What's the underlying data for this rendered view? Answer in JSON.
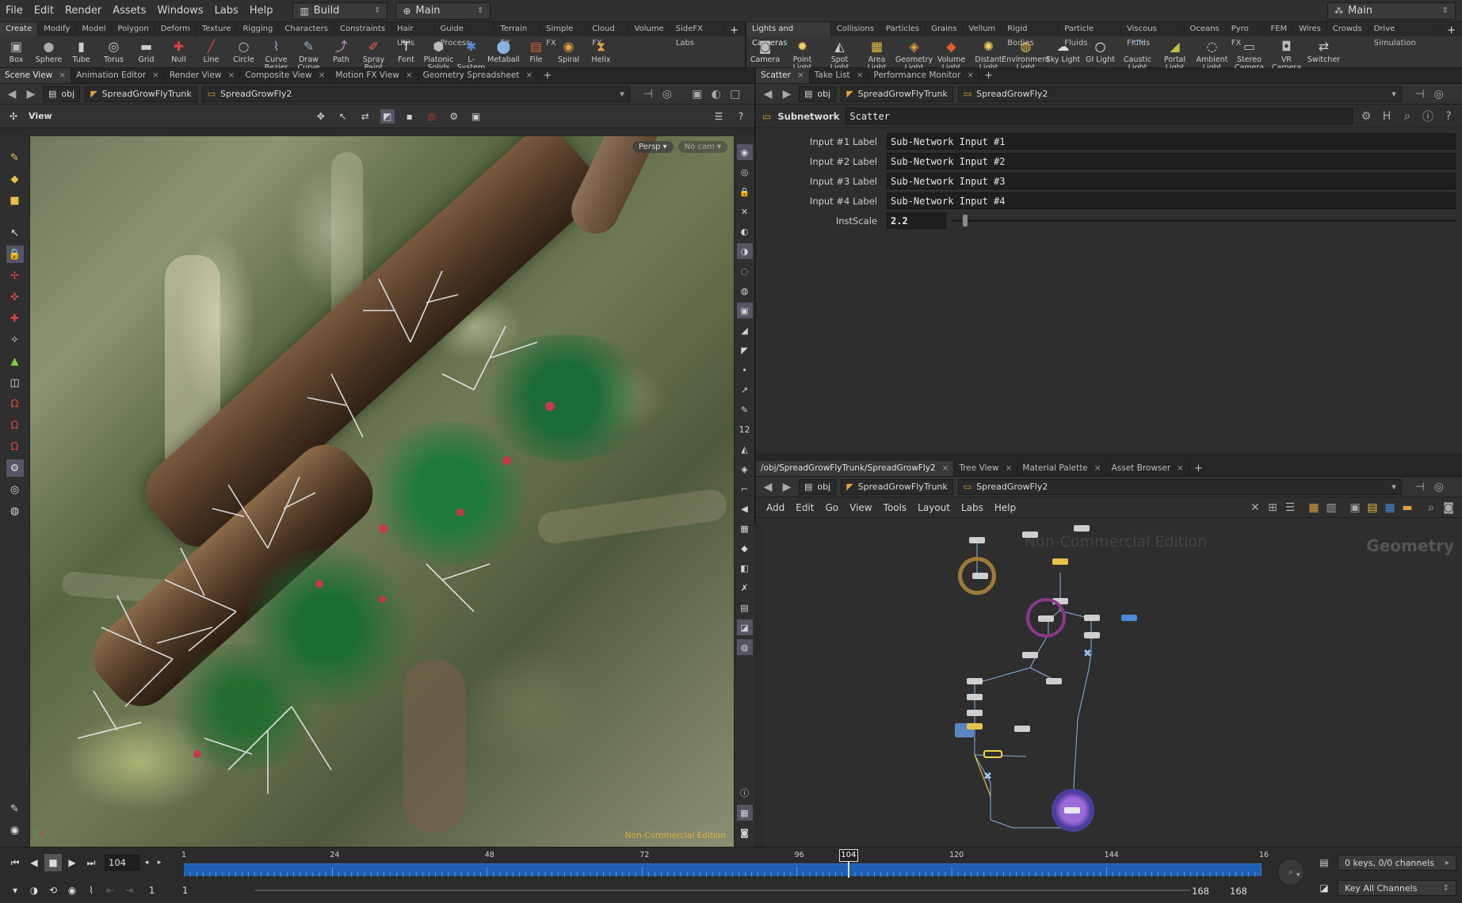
{
  "menubar": {
    "items": [
      "File",
      "Edit",
      "Render",
      "Assets",
      "Windows",
      "Labs",
      "Help"
    ],
    "desktop": "Build",
    "context": "Main",
    "right_context": "Main"
  },
  "left_shelf": {
    "tabs": [
      "Create",
      "Modify",
      "Model",
      "Polygon",
      "Deform",
      "Texture",
      "Rigging",
      "Characters",
      "Constraints",
      "Hair Utils",
      "Guide Process",
      "Terrain FX",
      "Simple FX",
      "Cloud FX",
      "Volume",
      "SideFX Labs"
    ],
    "tools": [
      {
        "label": "Box",
        "icon": "box-icon",
        "glyph": "▣"
      },
      {
        "label": "Sphere",
        "icon": "sphere-icon",
        "glyph": "●"
      },
      {
        "label": "Tube",
        "icon": "tube-icon",
        "glyph": "▮"
      },
      {
        "label": "Torus",
        "icon": "torus-icon",
        "glyph": "◎"
      },
      {
        "label": "Grid",
        "icon": "grid-icon",
        "glyph": "▬"
      },
      {
        "label": "Null",
        "icon": "null-icon",
        "glyph": "✚"
      },
      {
        "label": "Line",
        "icon": "line-icon",
        "glyph": "╱"
      },
      {
        "label": "Circle",
        "icon": "circle-icon",
        "glyph": "○"
      },
      {
        "label": "Curve Bezier",
        "icon": "curve-bezier-icon",
        "glyph": "⌇"
      },
      {
        "label": "Draw Curve",
        "icon": "draw-curve-icon",
        "glyph": "✎"
      },
      {
        "label": "Path",
        "icon": "path-icon",
        "glyph": "⤴"
      },
      {
        "label": "Spray Paint",
        "icon": "spray-paint-icon",
        "glyph": "✐"
      },
      {
        "label": "Font",
        "icon": "font-icon",
        "glyph": "T"
      },
      {
        "label": "Platonic Solids",
        "icon": "platonic-solids-icon",
        "glyph": "⬢"
      },
      {
        "label": "L-System",
        "icon": "l-system-icon",
        "glyph": "✱"
      },
      {
        "label": "Metaball",
        "icon": "metaball-icon",
        "glyph": "⬤"
      },
      {
        "label": "File",
        "icon": "file-icon",
        "glyph": "▤"
      },
      {
        "label": "Spiral",
        "icon": "spiral-icon",
        "glyph": "◉"
      },
      {
        "label": "Helix",
        "icon": "helix-icon",
        "glyph": "⧗"
      }
    ]
  },
  "right_shelf": {
    "tabs": [
      "Lights and Cameras",
      "Collisions",
      "Particles",
      "Grains",
      "Vellum",
      "Rigid Bodies",
      "Particle Fluids",
      "Viscous Fluids",
      "Oceans",
      "Pyro FX",
      "FEM",
      "Wires",
      "Crowds",
      "Drive Simulation"
    ],
    "tools": [
      {
        "label": "Camera",
        "icon": "camera-icon",
        "glyph": "◙"
      },
      {
        "label": "Point Light",
        "icon": "point-light-icon",
        "glyph": "✹"
      },
      {
        "label": "Spot Light",
        "icon": "spot-light-icon",
        "glyph": "◭"
      },
      {
        "label": "Area Light",
        "icon": "area-light-icon",
        "glyph": "▦"
      },
      {
        "label": "Geometry Light",
        "icon": "geometry-light-icon",
        "glyph": "◈"
      },
      {
        "label": "Volume Light",
        "icon": "volume-light-icon",
        "glyph": "◆"
      },
      {
        "label": "Distant Light",
        "icon": "distant-light-icon",
        "glyph": "✺"
      },
      {
        "label": "Environment Light",
        "icon": "environment-light-icon",
        "glyph": "◍"
      },
      {
        "label": "Sky Light",
        "icon": "sky-light-icon",
        "glyph": "☁"
      },
      {
        "label": "GI Light",
        "icon": "gi-light-icon",
        "glyph": "○"
      },
      {
        "label": "Caustic Light",
        "icon": "caustic-light-icon",
        "glyph": "⌒"
      },
      {
        "label": "Portal Light",
        "icon": "portal-light-icon",
        "glyph": "◢"
      },
      {
        "label": "Ambient Light",
        "icon": "ambient-light-icon",
        "glyph": "◌"
      },
      {
        "label": "Stereo Camera",
        "icon": "stereo-camera-icon",
        "glyph": "▭"
      },
      {
        "label": "VR Camera",
        "icon": "vr-camera-icon",
        "glyph": "◘"
      },
      {
        "label": "Switcher",
        "icon": "switcher-icon",
        "glyph": "⇄"
      }
    ]
  },
  "left_pane": {
    "tabs": [
      "Scene View",
      "Animation Editor",
      "Render View",
      "Composite View",
      "Motion FX View",
      "Geometry Spreadsheet"
    ],
    "path": [
      "obj",
      "SpreadGrowFlyTrunk",
      "SpreadGrowFly2"
    ],
    "view_label": "View",
    "persp": "Persp",
    "cam": "No cam",
    "watermark": "Non-Commercial Edition"
  },
  "param_pane": {
    "tabs": [
      "Scatter",
      "Take List",
      "Performance Monitor"
    ],
    "path": [
      "obj",
      "SpreadGrowFlyTrunk",
      "SpreadGrowFly2"
    ],
    "node_type": "Subnetwork",
    "node_name": "Scatter",
    "params": [
      {
        "label": "Input #1 Label",
        "value": "Sub-Network Input #1"
      },
      {
        "label": "Input #2 Label",
        "value": "Sub-Network Input #2"
      },
      {
        "label": "Input #3 Label",
        "value": "Sub-Network Input #3"
      },
      {
        "label": "Input #4 Label",
        "value": "Sub-Network Input #4"
      }
    ],
    "instscale": {
      "label": "InstScale",
      "value": "2.2",
      "slider_fraction": 0.02
    }
  },
  "network_pane": {
    "tabs": [
      "/obj/SpreadGrowFlyTrunk/SpreadGrowFly2",
      "Tree View",
      "Material Palette",
      "Asset Browser"
    ],
    "path": [
      "obj",
      "SpreadGrowFlyTrunk",
      "SpreadGrowFly2"
    ],
    "menu": [
      "Add",
      "Edit",
      "Go",
      "View",
      "Tools",
      "Layout",
      "Labs",
      "Help"
    ],
    "watermark": "Non-Commercial Edition",
    "context_label": "Geometry"
  },
  "timeline": {
    "current_frame": "104",
    "ticks": [
      "1",
      "24",
      "48",
      "72",
      "96",
      "120",
      "144",
      "16"
    ],
    "playhead": "104",
    "start": "1",
    "start2": "1",
    "end": "168",
    "end2": "168",
    "keys_label": "0 keys, 0/0 channels",
    "key_all": "Key All Channels"
  },
  "colors": {
    "accent": "#1f5fb3",
    "orange": "#e3a83a",
    "selected_node": "#f0d34a"
  }
}
